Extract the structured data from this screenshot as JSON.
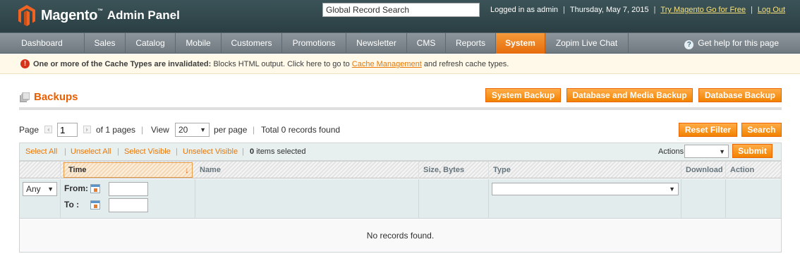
{
  "header": {
    "logo_text": "Magento",
    "logo_sub": "Admin Panel",
    "logo_tm": "™",
    "global_search_value": "Global Record Search",
    "logged_in": "Logged in as admin",
    "date": "Thursday, May 7, 2015",
    "try_link": "Try Magento Go for Free",
    "logout_link": "Log Out"
  },
  "nav": {
    "items": [
      {
        "label": "Dashboard"
      },
      {
        "label": "Sales"
      },
      {
        "label": "Catalog"
      },
      {
        "label": "Mobile"
      },
      {
        "label": "Customers"
      },
      {
        "label": "Promotions"
      },
      {
        "label": "Newsletter"
      },
      {
        "label": "CMS"
      },
      {
        "label": "Reports"
      },
      {
        "label": "System",
        "active": true
      },
      {
        "label": "Zopim Live Chat"
      }
    ],
    "help": "Get help for this page",
    "active_color": "#eb5e00"
  },
  "notice": {
    "strong": "One or more of the Cache Types are invalidated:",
    "text_before": " Blocks HTML output. Click here to go to ",
    "link": "Cache Management",
    "text_after": " and refresh cache types."
  },
  "page": {
    "title": "Backups",
    "buttons": {
      "system_backup": "System Backup",
      "db_media_backup": "Database and Media Backup",
      "db_backup": "Database Backup"
    }
  },
  "pager": {
    "page_label": "Page",
    "page_value": "1",
    "of_pages": "of 1 pages",
    "view_label": "View",
    "per_page_value": "20",
    "per_page_label": "per page",
    "total": "Total 0 records found",
    "reset_filter": "Reset Filter",
    "search": "Search"
  },
  "massaction": {
    "select_all": "Select All",
    "unselect_all": "Unselect All",
    "select_visible": "Select Visible",
    "unselect_visible": "Unselect Visible",
    "items_selected_count": "0",
    "items_selected_label": "items selected",
    "actions_label": "Actions",
    "submit": "Submit"
  },
  "grid": {
    "columns": [
      "Time",
      "Name",
      "Size, Bytes",
      "Type",
      "Download",
      "Action"
    ],
    "filter": {
      "any_value": "Any",
      "from_label": "From:",
      "to_label": "To :"
    },
    "empty_text": "No records found."
  }
}
